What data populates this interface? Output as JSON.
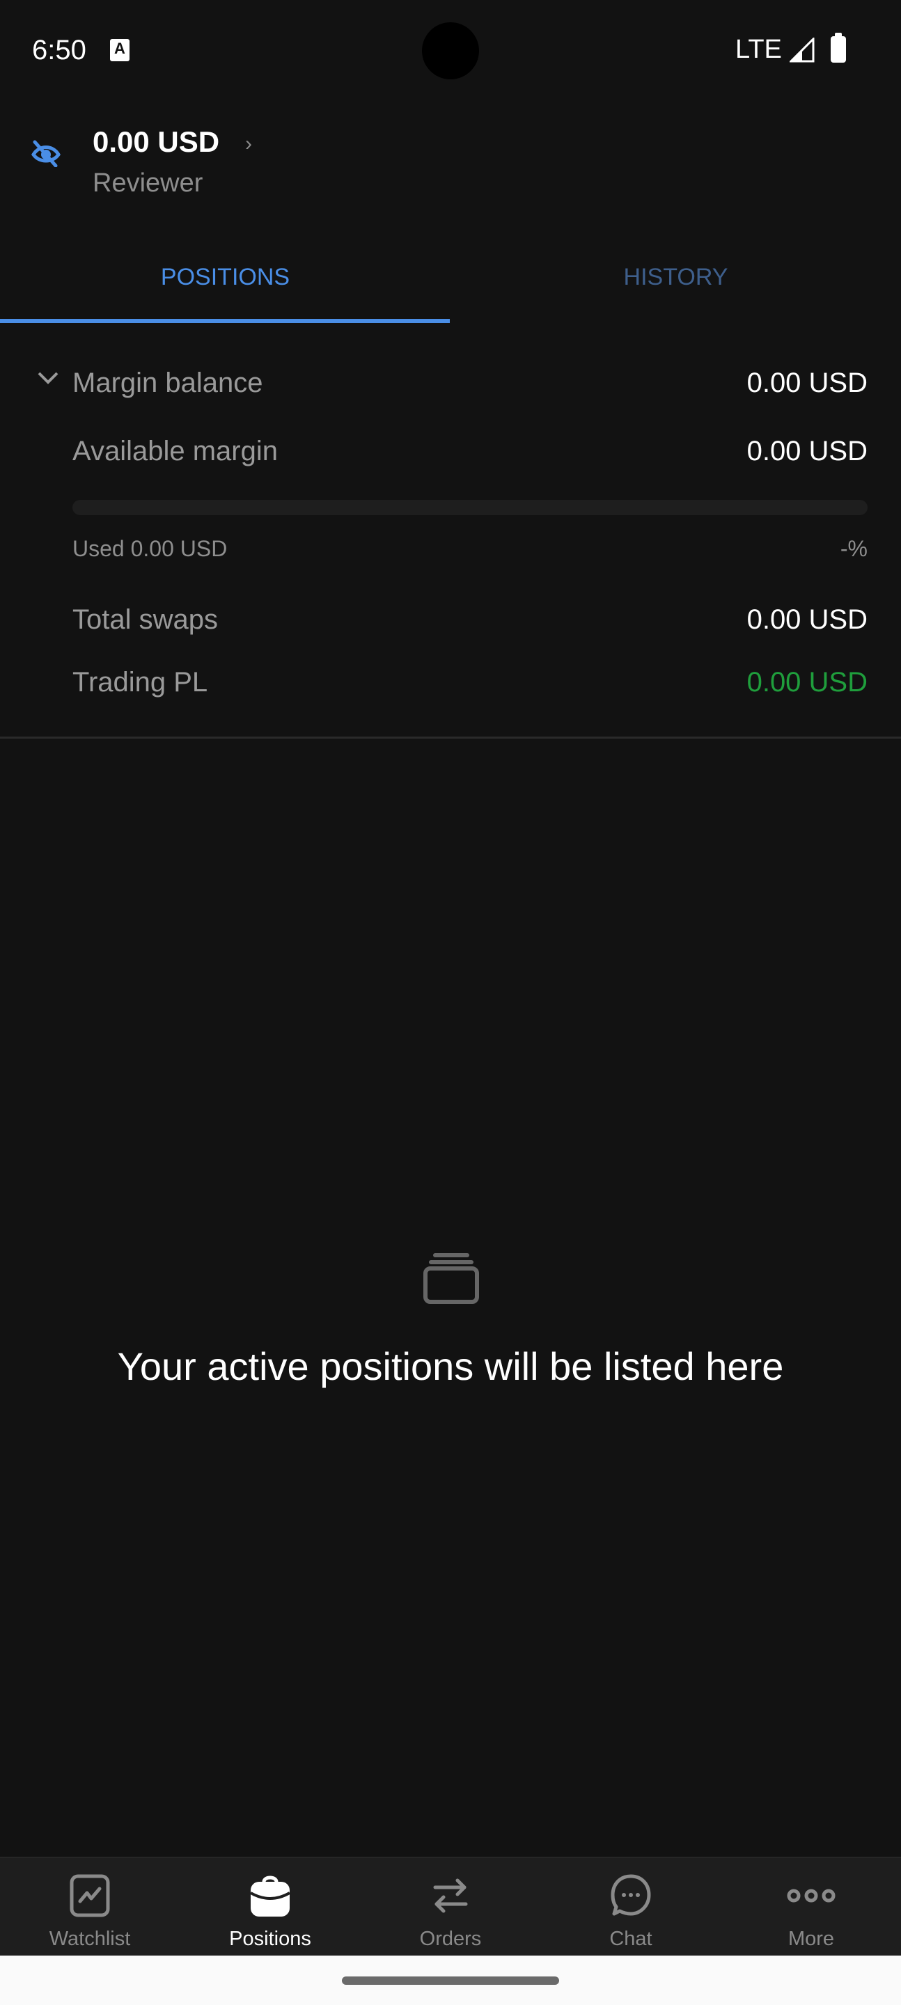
{
  "status_bar": {
    "time": "6:50",
    "notification_icon": "a-icon",
    "network": "LTE",
    "signal_icon": "signal-icon",
    "battery_icon": "battery-icon"
  },
  "header": {
    "visibility_icon": "eye-off-icon",
    "balance": "0.00 USD",
    "chevron": "›",
    "account_name": "Reviewer"
  },
  "tabs": [
    {
      "label": "POSITIONS",
      "active": true
    },
    {
      "label": "HISTORY",
      "active": false
    }
  ],
  "summary": {
    "margin_balance": {
      "label": "Margin balance",
      "value": "0.00 USD"
    },
    "available_margin": {
      "label": "Available margin",
      "value": "0.00 USD"
    },
    "margin_usage": {
      "used_label": "Used 0.00 USD",
      "percent_label": "-%",
      "fill_fraction": 0
    },
    "total_swaps": {
      "label": "Total swaps",
      "value": "0.00 USD"
    },
    "trading_pl": {
      "label": "Trading PL",
      "value": "0.00 USD"
    }
  },
  "empty_state": {
    "icon": "stack-icon",
    "message": "Your active positions will be listed here"
  },
  "bottom_nav": [
    {
      "label": "Watchlist",
      "icon": "chart-icon",
      "active": false
    },
    {
      "label": "Positions",
      "icon": "briefcase-icon",
      "active": true
    },
    {
      "label": "Orders",
      "icon": "swap-arrows-icon",
      "active": false
    },
    {
      "label": "Chat",
      "icon": "chat-bubble-icon",
      "active": false
    },
    {
      "label": "More",
      "icon": "more-dots-icon",
      "active": false
    }
  ],
  "colors": {
    "accent": "#4a8ee6",
    "inactive_tab": "#3e5f8c",
    "profit_green": "#1f9e3c",
    "background": "#121212",
    "nav_background": "#1e1e1e"
  }
}
